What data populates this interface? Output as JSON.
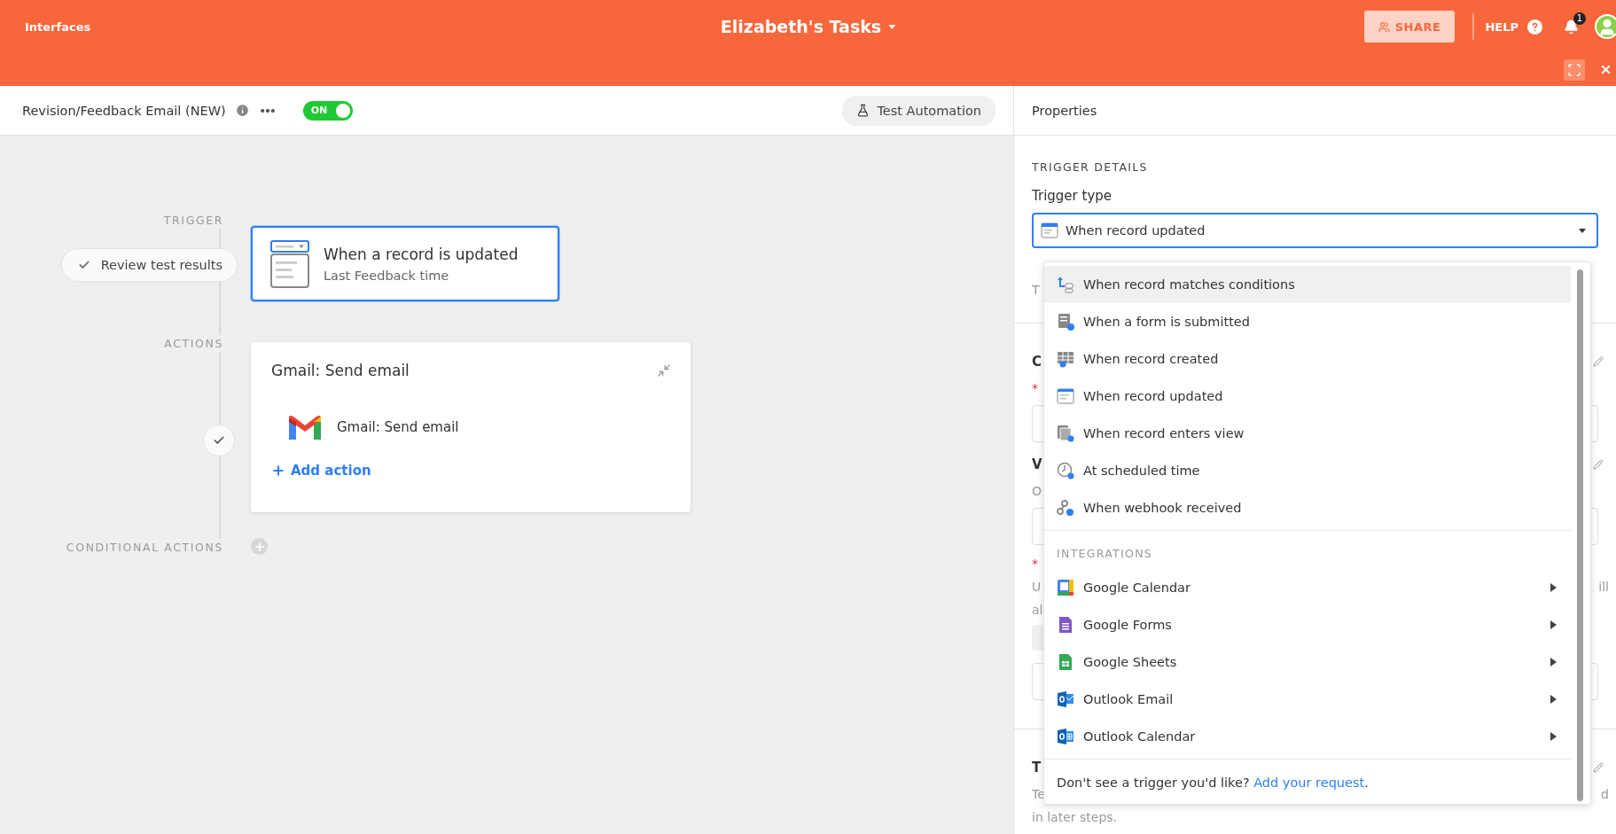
{
  "header": {
    "app_link": "Interfaces",
    "title": "Elizabeth's Tasks",
    "share": "SHARE",
    "help": "HELP",
    "notifications": "1"
  },
  "toolbar": {
    "automation_name": "Revision/Feedback Email (NEW)",
    "toggle": {
      "label": "ON",
      "on": true
    },
    "test_button": "Test Automation"
  },
  "canvas": {
    "trigger_label": "TRIGGER",
    "review_button": "Review test results",
    "trigger_card": {
      "title": "When a record is updated",
      "subtitle": "Last Feedback time",
      "selected": true
    },
    "actions_label": "ACTIONS",
    "action_card": {
      "title": "Gmail: Send email",
      "step": "Gmail: Send email",
      "add": "Add action"
    },
    "conditional_label": "CONDITIONAL ACTIONS"
  },
  "properties": {
    "title": "Properties",
    "section": "TRIGGER DETAILS",
    "field_label": "Trigger type",
    "value": "When record updated",
    "open": true,
    "rows": [
      {
        "kind": "hint",
        "left": "T"
      },
      {
        "kind": "divider"
      },
      {
        "kind": "heading",
        "left": "C"
      },
      {
        "kind": "required",
        "left": "*"
      },
      {
        "kind": "field"
      },
      {
        "kind": "heading",
        "left": "V"
      },
      {
        "kind": "hint",
        "left": "O"
      },
      {
        "kind": "field"
      },
      {
        "kind": "required",
        "left": "*"
      },
      {
        "kind": "hint",
        "left": "U",
        "right": "ill"
      },
      {
        "kind": "hint",
        "left": "al"
      },
      {
        "kind": "chip"
      },
      {
        "kind": "field"
      },
      {
        "kind": "divider"
      },
      {
        "kind": "heading",
        "left": "T"
      },
      {
        "kind": "hint",
        "left": "Te",
        "right": "d"
      },
      {
        "kind": "hint",
        "left": "in later steps."
      }
    ]
  },
  "dropdown": {
    "options": [
      {
        "label": "When record matches conditions",
        "highlighted": true
      },
      {
        "label": "When a form is submitted",
        "highlighted": false
      },
      {
        "label": "When record created",
        "highlighted": false
      },
      {
        "label": "When record updated",
        "highlighted": false
      },
      {
        "label": "When record enters view",
        "highlighted": false
      },
      {
        "label": "At scheduled time",
        "highlighted": false
      },
      {
        "label": "When webhook received",
        "highlighted": false
      }
    ],
    "group_title": "INTEGRATIONS",
    "integrations": [
      {
        "label": "Google Calendar"
      },
      {
        "label": "Google Forms"
      },
      {
        "label": "Google Sheets"
      },
      {
        "label": "Outlook Email"
      },
      {
        "label": "Outlook Calendar"
      }
    ],
    "footer": {
      "text": "Don't see a trigger you'd like?",
      "link": "Add your request",
      "end": "."
    }
  }
}
